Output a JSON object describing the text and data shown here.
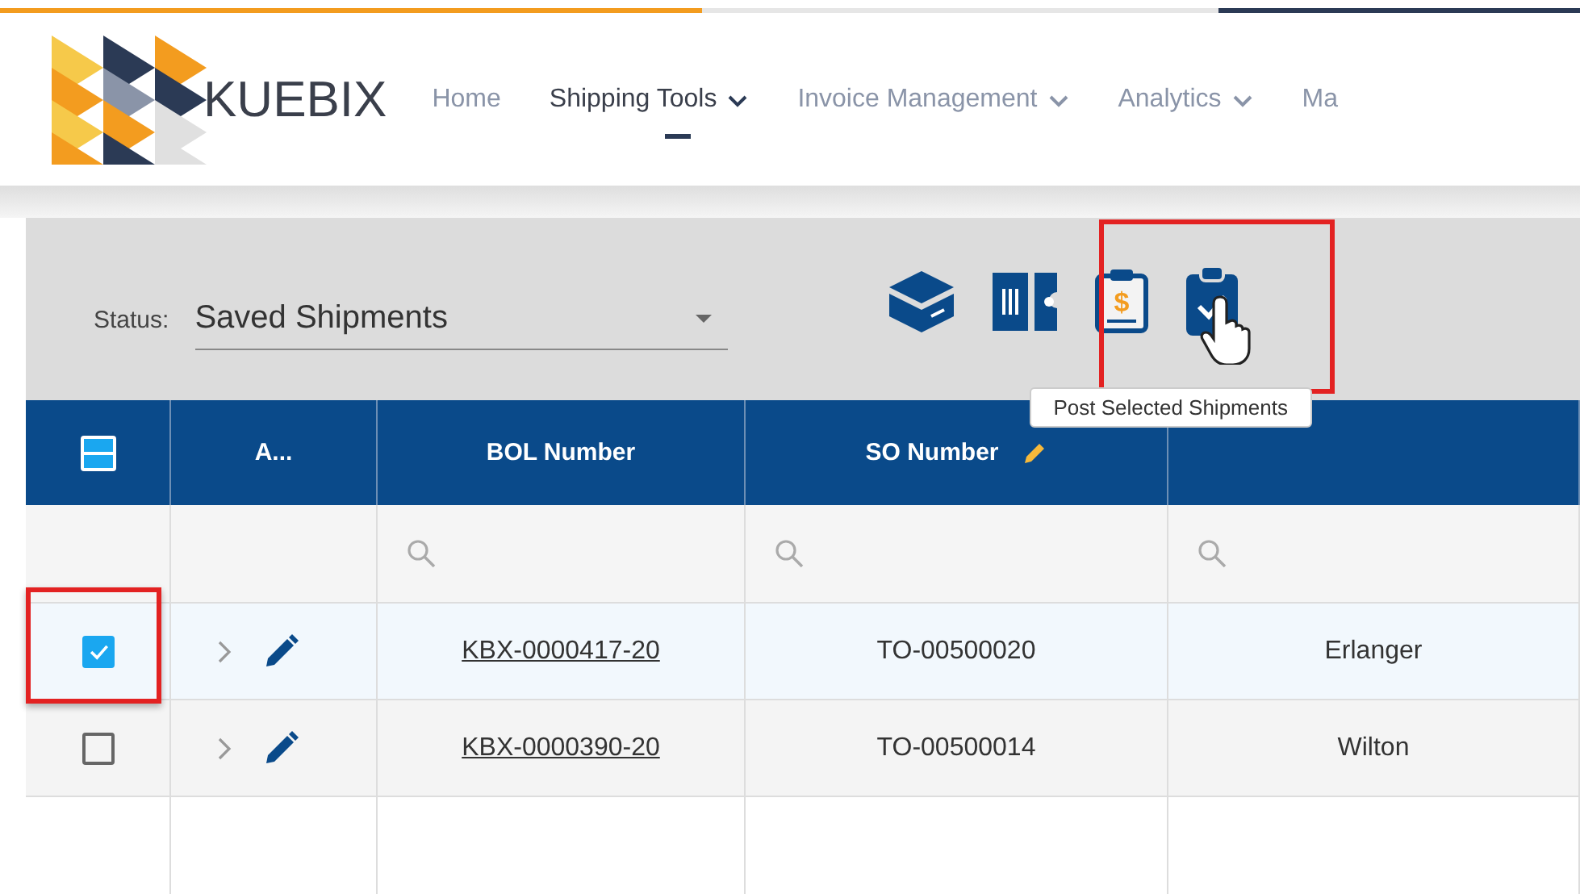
{
  "logo": {
    "text": "KUEBIX"
  },
  "nav": [
    {
      "label": "Home",
      "selected": false,
      "dropdown": false
    },
    {
      "label": "Shipping Tools",
      "selected": true,
      "dropdown": true
    },
    {
      "label": "Invoice Management",
      "selected": false,
      "dropdown": true
    },
    {
      "label": "Analytics",
      "selected": false,
      "dropdown": true
    },
    {
      "label": "Ma",
      "selected": false,
      "dropdown": false
    }
  ],
  "status": {
    "label": "Status:",
    "value": "Saved Shipments"
  },
  "toolbar": [
    {
      "kind": "box",
      "highlighted": false
    },
    {
      "kind": "ticket",
      "highlighted": false
    },
    {
      "kind": "invoice",
      "highlighted": false,
      "symbol": "$"
    },
    {
      "kind": "post",
      "highlighted": true
    }
  ],
  "tooltip": "Post Selected Shipments",
  "table": {
    "select_all": {
      "indeterminate": true
    },
    "columns": [
      {
        "label": "A...",
        "editable": false,
        "filter": false
      },
      {
        "label": "BOL Number",
        "editable": false,
        "filter": true
      },
      {
        "label": "SO Number",
        "editable": true,
        "filter": true
      },
      {
        "filter": true
      }
    ],
    "rows": [
      {
        "checked": true,
        "highlighted": true,
        "bol": "KBX-0000417-20",
        "so": "TO-00500020",
        "column_4": "Erlanger"
      },
      {
        "checked": false,
        "highlighted": false,
        "bol": "KBX-0000390-20",
        "so": "TO-00500014",
        "column_4": "Wilton"
      }
    ]
  }
}
